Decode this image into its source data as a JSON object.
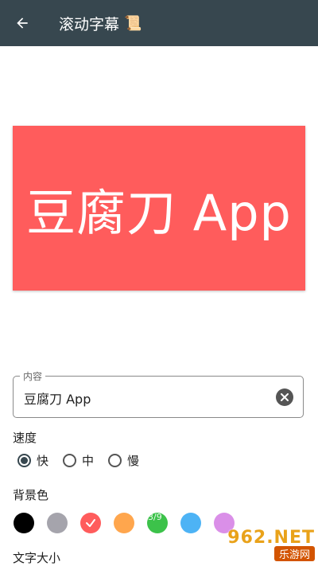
{
  "appbar": {
    "title": "滚动字幕",
    "title_emoji": "📜",
    "back_icon": "arrow-back-icon",
    "background": "#37474f"
  },
  "preview": {
    "text": "豆腐刀 App",
    "background": "#ff5c5c",
    "text_color": "#ffffff"
  },
  "content_field": {
    "label": "内容",
    "value": "豆腐刀 App"
  },
  "speed": {
    "label": "速度",
    "options": [
      {
        "label": "快",
        "checked": true
      },
      {
        "label": "中",
        "checked": false
      },
      {
        "label": "慢",
        "checked": false
      }
    ]
  },
  "background_color": {
    "label": "背景色",
    "swatches": [
      {
        "color": "#000000",
        "selected": false
      },
      {
        "color": "#a5a4ac",
        "selected": false
      },
      {
        "color": "#ff5c5c",
        "selected": true
      },
      {
        "color": "#ffa64d",
        "selected": false
      },
      {
        "color": "#3cc24a",
        "selected": false,
        "overlay": "3/9"
      },
      {
        "color": "#4db3f5",
        "selected": false
      },
      {
        "color": "#da8fe8",
        "selected": false
      }
    ]
  },
  "text_size": {
    "label": "文字大小"
  },
  "watermark": {
    "brand": "962.NET",
    "sub": "乐游网"
  }
}
